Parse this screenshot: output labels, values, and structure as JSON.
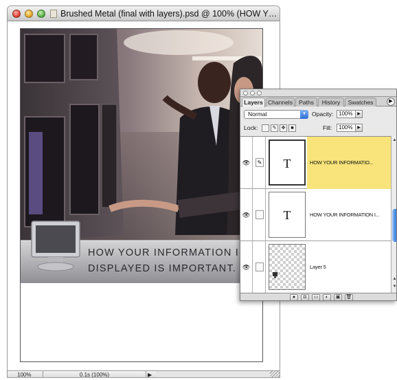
{
  "document": {
    "title": "Brushed Metal (final with layers).psd @ 100% (HOW YO...",
    "artwork_text_line1": "HOW YOUR INFORMATION IS",
    "artwork_text_line2": "DISPLAYED IS IMPORTANT.",
    "status": {
      "zoom": "100%",
      "info": "0.1s (100%)"
    }
  },
  "palette": {
    "tabs": [
      {
        "label": "Layers",
        "active": true
      },
      {
        "label": "Channels",
        "active": false
      },
      {
        "label": "Paths",
        "active": false
      },
      {
        "label": "History",
        "active": false
      },
      {
        "label": "Swatches",
        "active": false
      }
    ],
    "blend_mode": "Normal",
    "opacity_label": "Opacity:",
    "opacity_value": "100%",
    "lock_label": "Lock:",
    "fill_label": "Fill:",
    "fill_value": "100%",
    "layers": [
      {
        "name": "HOW YOUR INFORMATIO...",
        "type": "text",
        "thumb_glyph": "T",
        "selected": true
      },
      {
        "name": "HOW YOUR INFORMATION I...",
        "type": "text",
        "thumb_glyph": "T",
        "selected": false
      },
      {
        "name": "Layer 5",
        "type": "pixel",
        "thumb_glyph": "",
        "selected": false
      }
    ]
  },
  "colors": {
    "selected_layer": "#f8e47a",
    "scroll_thumb": "#3a7fe0"
  }
}
